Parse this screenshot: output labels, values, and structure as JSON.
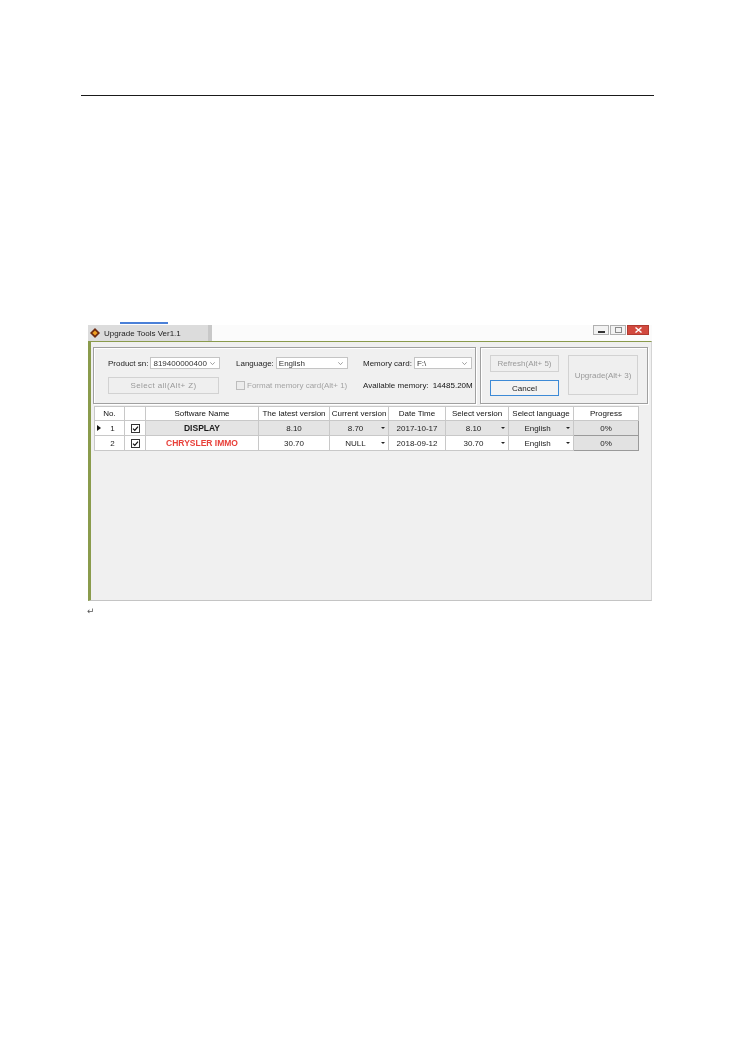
{
  "window": {
    "title": "Upgrade Tools Ver1.1"
  },
  "settings": {
    "product_sn": {
      "label": "Product sn:",
      "value": "819400000400"
    },
    "language": {
      "label": "Language:",
      "value": "English"
    },
    "memory_card": {
      "label": "Memory card:",
      "value": "F:\\"
    },
    "select_all": {
      "label": "Select all(Alt+ Z)",
      "disabled": true
    },
    "format_card": {
      "label": "Format memory card(Alt+ 1)",
      "checked": false,
      "disabled": true
    },
    "available_memory": {
      "label": "Available memory:",
      "value": "14485.20M"
    }
  },
  "actions": {
    "refresh": {
      "label": "Refresh(Alt+ 5)",
      "disabled": true,
      "focused": false
    },
    "cancel": {
      "label": "Cancel",
      "disabled": false,
      "focused": true
    },
    "upgrade": {
      "label": "Upgrade(Alt+ 3)",
      "disabled": true,
      "focused": false
    }
  },
  "table": {
    "columns": [
      "No.",
      "Software Name",
      "The latest version",
      "Current version",
      "Date Time",
      "Select version",
      "Select language",
      "Progress"
    ],
    "rows": [
      {
        "no": "1",
        "current": true,
        "selected": true,
        "checked": true,
        "name": "DISPLAY",
        "color": "#1a1a1a",
        "latest_version": "8.10",
        "current_version": "8.70",
        "date_time": "2017-10-17",
        "select_version": "8.10",
        "select_language": "English",
        "progress": "0%"
      },
      {
        "no": "2",
        "current": false,
        "selected": false,
        "checked": true,
        "name": "CHRYSLER IMMO",
        "color": "#e8403a",
        "latest_version": "30.70",
        "current_version": "NULL",
        "date_time": "2018-09-12",
        "select_version": "30.70",
        "select_language": "English",
        "progress": "0%"
      }
    ]
  },
  "document": {
    "return_mark": "↵"
  }
}
